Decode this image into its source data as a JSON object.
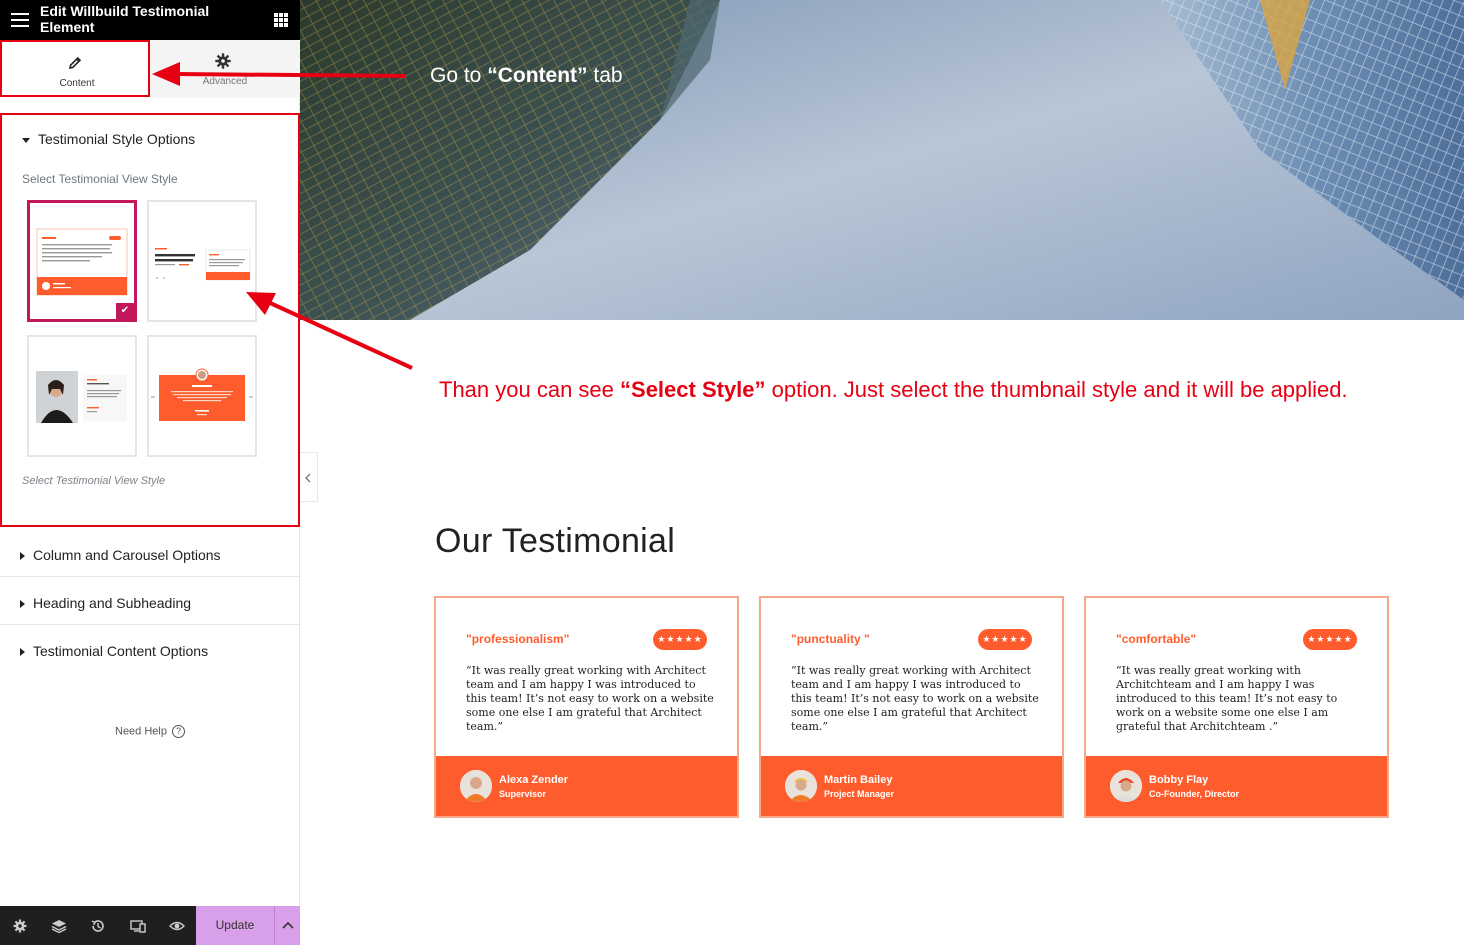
{
  "topbar": {
    "title": "Edit Willbuild Testimonial Element"
  },
  "tabs": [
    {
      "label": "Content"
    },
    {
      "label": "Advanced"
    }
  ],
  "style_section": {
    "heading": "Testimonial Style Options",
    "field_label": "Select Testimonial View Style",
    "help_text": "Select Testimonial View Style",
    "thumbnails": [
      {
        "name": "Style 1",
        "selected": true
      },
      {
        "name": "Style 2",
        "selected": false
      },
      {
        "name": "Style 3",
        "selected": false
      },
      {
        "name": "Style 4",
        "selected": false
      }
    ]
  },
  "collapsed_sections": [
    {
      "label": "Column and Carousel Options"
    },
    {
      "label": "Heading and Subheading"
    },
    {
      "label": "Testimonial Content Options"
    }
  ],
  "need_help": "Need Help",
  "help_icon_glyph": "?",
  "bottombar": {
    "update_label": "Update"
  },
  "annotations": {
    "go_prefix": "Go  to ",
    "go_bold": "“Content”",
    "go_suffix": " tab",
    "select_prefix": "Than you can see ",
    "select_bold": "“Select Style”",
    "select_suffix": " option. Just select the thumbnail style and it will be applied."
  },
  "preview": {
    "section_title": "Our Testimonial",
    "testimonials": [
      {
        "headline": "\"professionalism\"",
        "rating": "★★★★★",
        "quote": "“It was really great working with Architect team and I am happy I was introduced to this team! It’s not easy to work on a website some one else I am grateful that Architect team.”",
        "name": "Alexa Zender",
        "role": "Supervisor"
      },
      {
        "headline": "\"punctuality \"",
        "rating": "★★★★★",
        "quote": "“It was really great working with Architect team and I am happy I was introduced to this team! It’s not easy to work on a website some one else I am grateful that Architect team.”",
        "name": "Martin Bailey",
        "role": "Project Manager"
      },
      {
        "headline": "\"comfortable\"",
        "rating": "★★★★★",
        "quote": "“It was really great working with Architchteam and I am happy I was introduced to this team! It’s not easy to work on a website some one else I am grateful that Architchteam .”",
        "name": "Bobby Flay",
        "role": "Co-Founder, Director"
      }
    ]
  },
  "colors": {
    "accent": "#ff5c2e",
    "annotation_red": "#e60012",
    "selection": "#c2185b",
    "update_button": "#d8a0e9"
  }
}
